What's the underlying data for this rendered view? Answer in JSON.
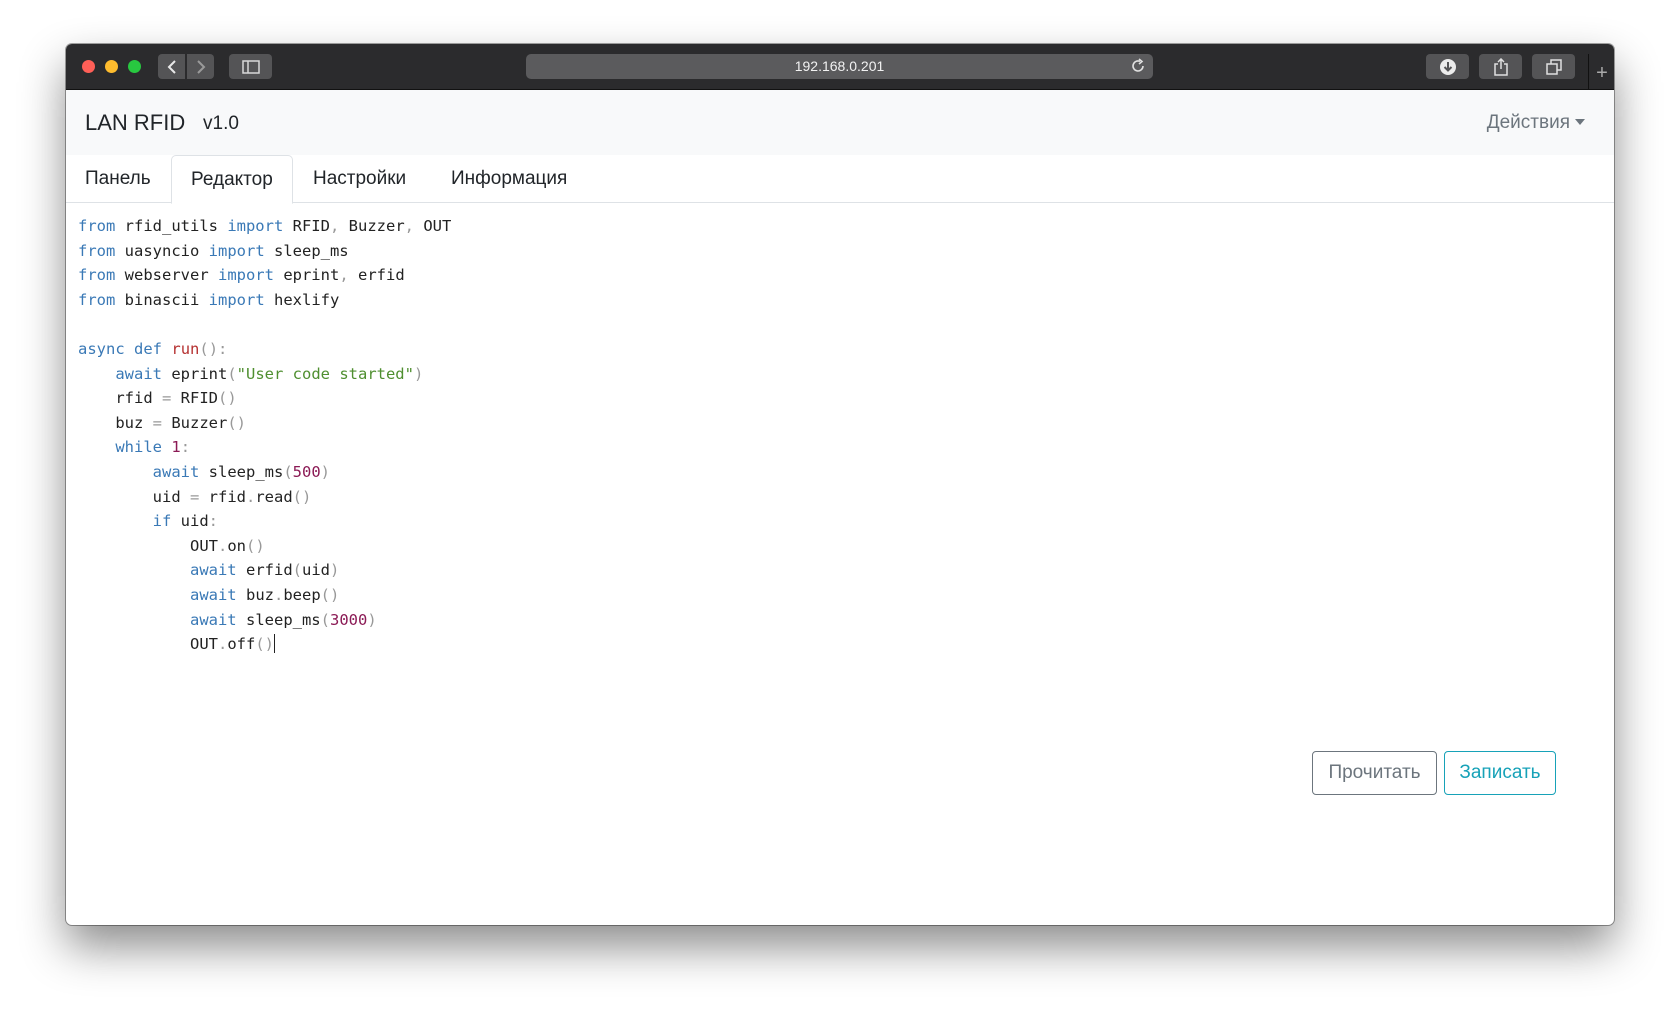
{
  "browser": {
    "url": "192.168.0.201",
    "new_tab_glyph": "+"
  },
  "navbar": {
    "brand": "LAN RFID",
    "version": "v1.0",
    "actions_label": "Действия"
  },
  "tabs": [
    {
      "label": "Панель",
      "active": false
    },
    {
      "label": "Редактор",
      "active": true
    },
    {
      "label": "Настройки",
      "active": false
    },
    {
      "label": "Информация",
      "active": false
    }
  ],
  "editor": {
    "lines": [
      "from rfid_utils import RFID, Buzzer, OUT",
      "from uasyncio import sleep_ms",
      "from webserver import eprint, erfid",
      "from binascii import hexlify",
      "",
      "async def run():",
      "    await eprint(\"User code started\")",
      "    rfid = RFID()",
      "    buz = Buzzer()",
      "    while 1:",
      "        await sleep_ms(500)",
      "        uid = rfid.read()",
      "        if uid:",
      "            OUT.on()",
      "            await erfid(uid)",
      "            await buz.beep()",
      "            await sleep_ms(3000)",
      "            OUT.off()"
    ]
  },
  "buttons": {
    "read_label": "Прочитать",
    "write_label": "Записать"
  },
  "colors": {
    "keyword": "#3a79b6",
    "function_def": "#b53030",
    "string": "#4f8f30",
    "number": "#8b1a55",
    "read_button": "#6c757d",
    "write_button": "#17a2b8"
  }
}
